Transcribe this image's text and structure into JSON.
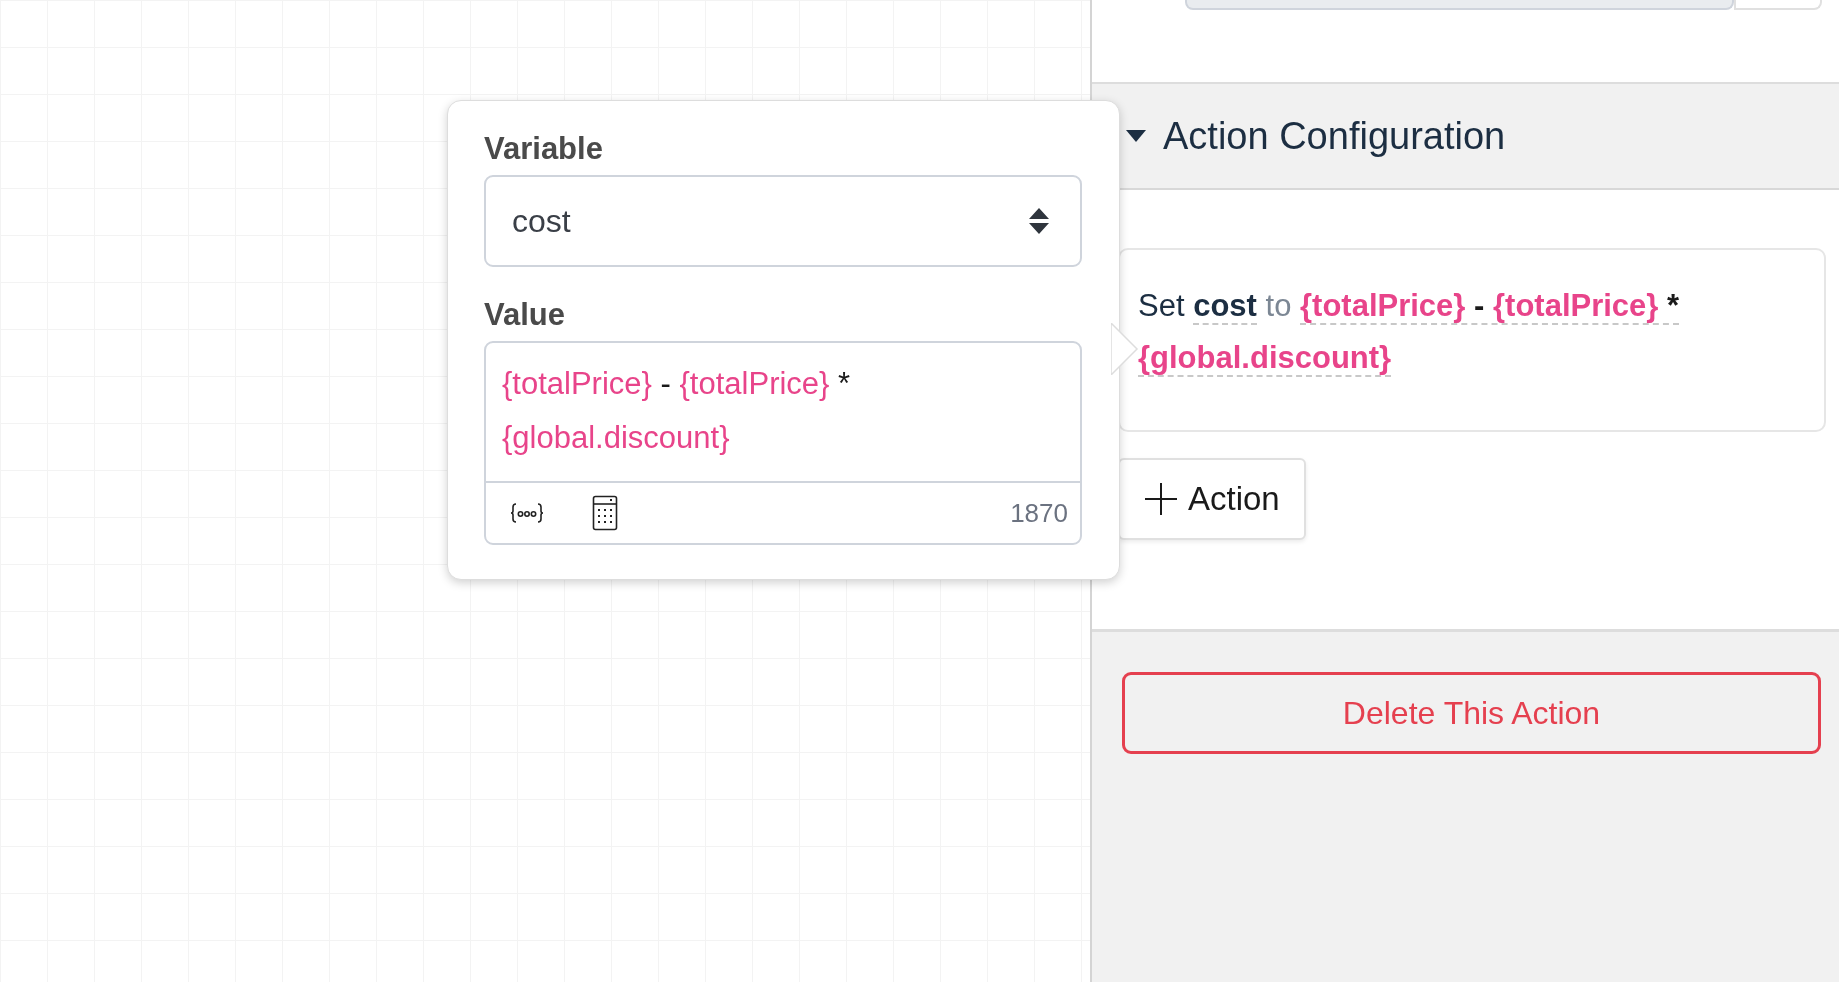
{
  "popover": {
    "variable_label": "Variable",
    "variable": "cost",
    "value_label": "Value",
    "value_tokens": [
      {
        "text": "{totalPrice}",
        "kind": "variable"
      },
      {
        "text": "-",
        "kind": "operator"
      },
      {
        "text": "{totalPrice}",
        "kind": "variable"
      },
      {
        "text": "*",
        "kind": "operator"
      },
      {
        "text": "{global.discount}",
        "kind": "variable"
      }
    ],
    "count": "1870"
  },
  "panel": {
    "section": {
      "title": "Action Configuration",
      "expanded": true
    },
    "action": {
      "verb": "Set",
      "variable": "cost",
      "connector": "to",
      "tokens": [
        {
          "text": "{totalPrice}",
          "kind": "variable"
        },
        {
          "text": "-",
          "kind": "operator"
        },
        {
          "text": "{totalPrice}",
          "kind": "variable"
        },
        {
          "text": "*",
          "kind": "operator"
        },
        {
          "text": "{global.discount}",
          "kind": "variable"
        }
      ]
    },
    "add_button": "Action",
    "delete_button": "Delete This Action"
  }
}
